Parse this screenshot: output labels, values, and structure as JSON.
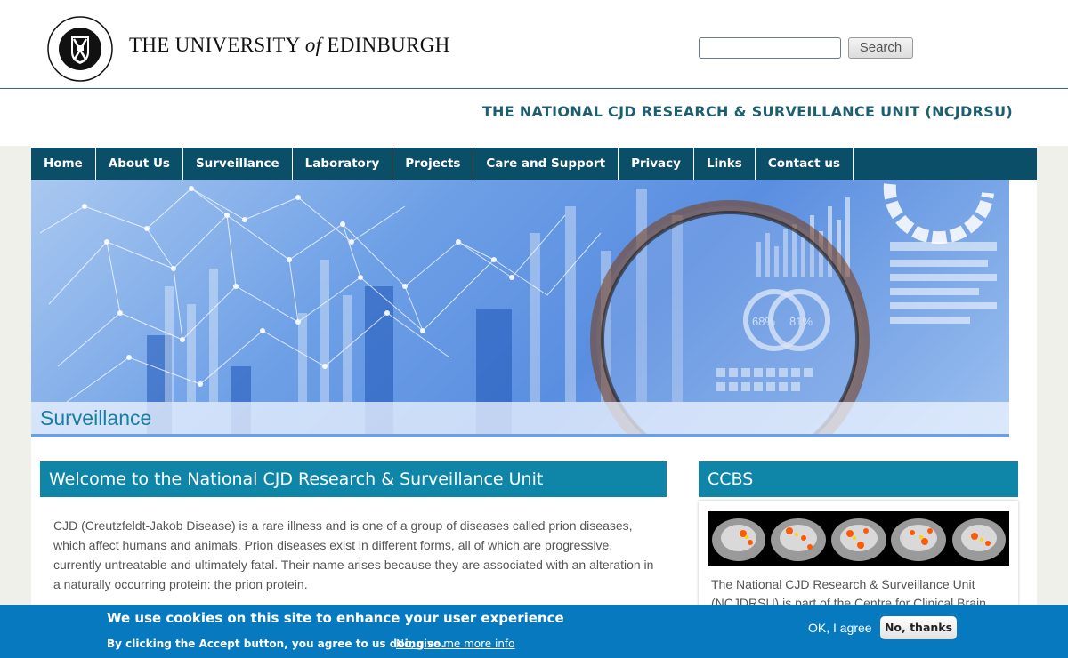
{
  "header": {
    "university_name_pre": "THE UNIVERSITY ",
    "university_name_of": "of",
    "university_name_post": " EDINBURGH",
    "crest_text": "THE UNIVERSITY OF EDINBURGH",
    "search": {
      "value": "",
      "placeholder": "",
      "button_label": "Search"
    }
  },
  "unit_title": "THE NATIONAL CJD RESEARCH & SURVEILLANCE UNIT (NCJDRSU)",
  "nav": {
    "items": [
      {
        "label": "Home"
      },
      {
        "label": "About Us"
      },
      {
        "label": "Surveillance"
      },
      {
        "label": "Laboratory"
      },
      {
        "label": "Projects"
      },
      {
        "label": "Care and Support"
      },
      {
        "label": "Privacy"
      },
      {
        "label": "Links"
      },
      {
        "label": "Contact us"
      }
    ]
  },
  "banner": {
    "title": "Surveillance",
    "gauge_a": "68%",
    "gauge_b": "81%"
  },
  "main": {
    "heading": "Welcome to the National CJD Research & Surveillance Unit",
    "intro": "CJD (Creutzfeldt-Jakob Disease) is a rare illness and is one of a group of diseases called prion diseases, which affect humans and animals.  Prion diseases exist in different forms, all of which are progressive, currently untreatable and ultimately fatal.  Their name arises because they are associated with an alteration in a naturally occurring protein: the prion protein."
  },
  "sidebar": {
    "heading": "CCBS",
    "text": "The National CJD Research & Surveillance Unit (NCJDRSU) is part of the Centre for Clinical Brain"
  },
  "cookie": {
    "title": "We use cookies on this site to enhance your user experience",
    "text": "By clicking the Accept button, you agree to us doing so.",
    "more_link": "No, give me more info",
    "agree": "OK, I agree",
    "decline": "No, thanks"
  },
  "colors": {
    "nav_bg": "#0b4e67",
    "heading_bg": "#0f86a7",
    "unit_title": "#1d5f6f",
    "cookie_bg": "#0779bf"
  }
}
